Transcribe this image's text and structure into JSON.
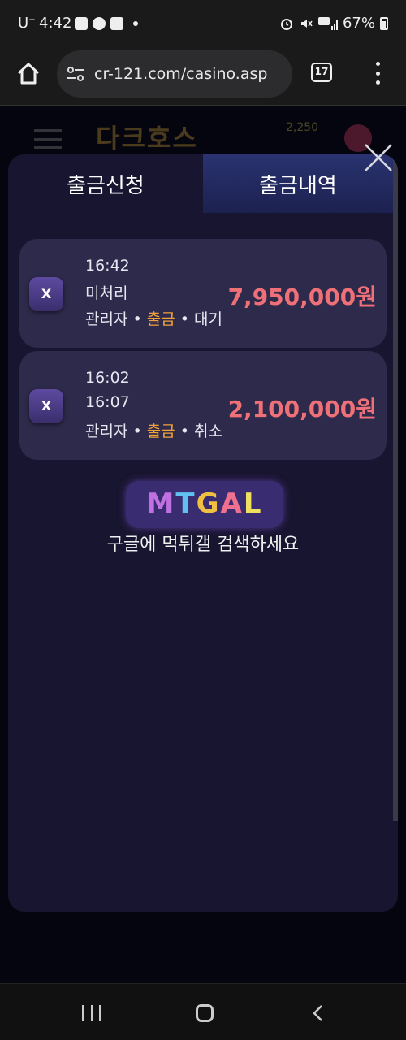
{
  "status_bar": {
    "carrier": "U",
    "carrier_sup": "+",
    "time": "4:42",
    "battery": "67%"
  },
  "browser": {
    "url": "cr-121.com/casino.asp",
    "tab_count": "17"
  },
  "site_header": {
    "logo_text": "다크호스",
    "balance": "2,250"
  },
  "modal": {
    "tabs": [
      {
        "label": "출금신청",
        "active": true
      },
      {
        "label": "출금내역",
        "active": false
      }
    ],
    "records": [
      {
        "close_label": "X",
        "line1": "16:42",
        "line2": "미처리",
        "meta_admin": "관리자",
        "meta_type": "출금",
        "meta_status": "대기",
        "amount": "7,950,000원"
      },
      {
        "close_label": "X",
        "line1": "16:02",
        "line2": "16:07",
        "meta_admin": "관리자",
        "meta_type": "출금",
        "meta_status": "취소",
        "amount": "2,100,000원"
      }
    ],
    "separator": "•",
    "watermark": {
      "logo_letters": [
        "M",
        "T",
        "G",
        "A",
        "L"
      ],
      "text": "구글에 먹튀갤 검색하세요"
    }
  },
  "colors": {
    "modal_bg": "#181530",
    "card_bg": "#2e2a4b",
    "amount": "#f07078",
    "highlight": "#f2a33a",
    "active_tab_bg": "#2a3370"
  }
}
